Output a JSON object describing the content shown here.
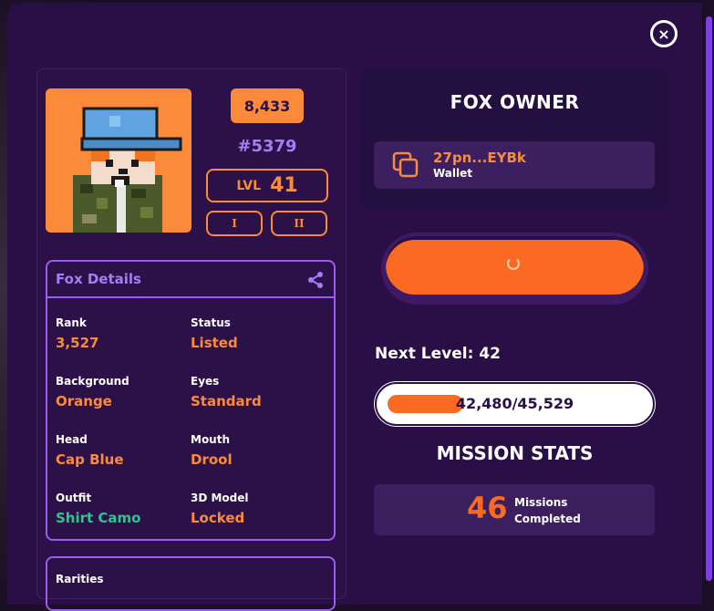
{
  "modal": {
    "close_label": "×"
  },
  "fox": {
    "score": "8,433",
    "id": "#5379",
    "level_label": "LVL",
    "level_value": "41",
    "gen_buttons": [
      "I",
      "II"
    ]
  },
  "details": {
    "title": "Fox Details",
    "traits": [
      {
        "key": "Rank",
        "value": "3,527"
      },
      {
        "key": "Status",
        "value": "Listed"
      },
      {
        "key": "Background",
        "value": "Orange"
      },
      {
        "key": "Eyes",
        "value": "Standard"
      },
      {
        "key": "Head",
        "value": "Cap Blue"
      },
      {
        "key": "Mouth",
        "value": "Drool"
      },
      {
        "key": "Outfit",
        "value": "Shirt Camo"
      },
      {
        "key": "3D Model",
        "value": "Locked"
      }
    ]
  },
  "rarities": {
    "title": "Rarities"
  },
  "owner": {
    "title": "FOX OWNER",
    "wallet_address": "27pn...EYBk",
    "wallet_label": "Wallet"
  },
  "progress": {
    "next_level_label": "Next Level: 42",
    "current": 42480,
    "target": 45529,
    "text": "42,480/45,529"
  },
  "missions": {
    "title": "MISSION STATS",
    "count": "46",
    "label_line1": "Missions",
    "label_line2": "Completed"
  },
  "colors": {
    "accent_orange": "#fb6a23",
    "label_orange": "#fb8a3b",
    "purple": "#a67df5",
    "green": "#2fc48f",
    "bg": "#2a0f47"
  },
  "icons": {
    "close": "close-icon",
    "share": "share-icon",
    "copy": "copy-icon",
    "spinner": "loading-spinner-icon"
  }
}
